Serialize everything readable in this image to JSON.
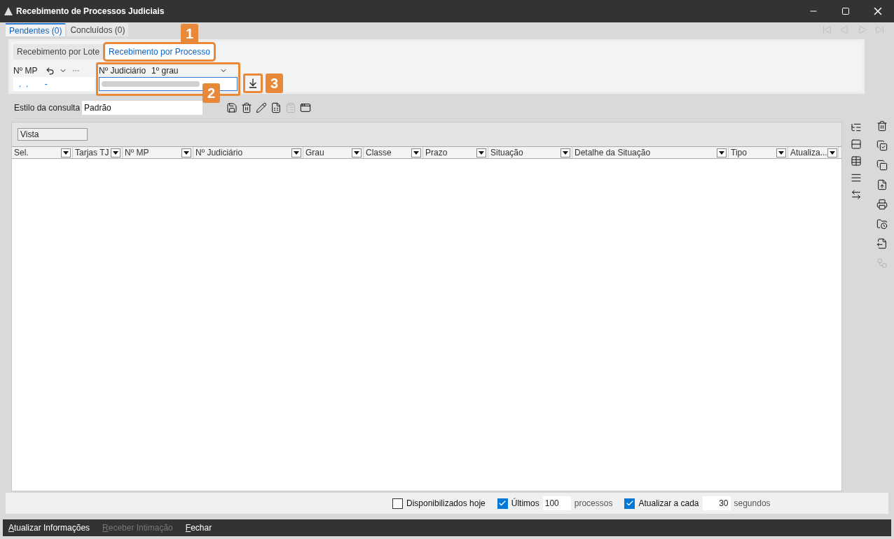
{
  "window": {
    "title": "Recebimento de Processos Judiciais"
  },
  "tabs": [
    {
      "label": "Pendentes (0)",
      "selected": true
    },
    {
      "label": "Concluídos (0)",
      "selected": false
    }
  ],
  "record_nav": [
    {
      "kind": "first",
      "disabled": true
    },
    {
      "kind": "prev",
      "disabled": true
    },
    {
      "kind": "next",
      "disabled": true
    },
    {
      "kind": "last",
      "disabled": true
    }
  ],
  "sub_tabs": [
    {
      "label": "Recebimento por Lote",
      "selected": false,
      "highlighted": false
    },
    {
      "label": "Recebimento por Processo",
      "selected": true,
      "highlighted": true,
      "callout": "1"
    }
  ],
  "mp_field": {
    "label": "Nº MP",
    "value": ".  .       -"
  },
  "judicial_field": {
    "label": "Nº Judiciário",
    "grade": "1º grau",
    "highlighted": true,
    "callout": "2"
  },
  "download_button": {
    "highlighted": true,
    "callout": "3"
  },
  "query_style": {
    "label": "Estilo da consulta",
    "value": "Padrão"
  },
  "style_toolbar": [
    {
      "kind": "save",
      "disabled": false
    },
    {
      "kind": "delete",
      "disabled": false
    },
    {
      "kind": "edit",
      "disabled": false
    },
    {
      "kind": "excel",
      "disabled": false
    },
    {
      "kind": "clipboard",
      "disabled": true
    },
    {
      "kind": "export",
      "disabled": false
    }
  ],
  "grid": {
    "group_box": "Vista",
    "columns": [
      "Sel.",
      "Tarjas TJ",
      "Nº MP",
      "Nº Judiciário",
      "Grau",
      "Classe",
      "Prazo",
      "Situação",
      "Detalhe da Situação",
      "Tipo",
      "Atualiza..."
    ]
  },
  "grid_tools": [
    {
      "kind": "tree",
      "disabled": false
    },
    {
      "kind": "rows",
      "disabled": false
    },
    {
      "kind": "table",
      "disabled": false
    },
    {
      "kind": "list",
      "disabled": false
    },
    {
      "kind": "fit",
      "disabled": false
    }
  ],
  "side_tools": [
    {
      "kind": "delete",
      "disabled": false
    },
    {
      "kind": "copy-check",
      "disabled": false
    },
    {
      "kind": "copy",
      "disabled": false
    },
    {
      "kind": "file-up",
      "disabled": false
    },
    {
      "kind": "print",
      "disabled": false
    },
    {
      "kind": "folder-clock",
      "disabled": false
    },
    {
      "kind": "file-out",
      "disabled": false
    },
    {
      "kind": "workflow",
      "disabled": true
    }
  ],
  "options": {
    "today": {
      "label": "Disponibilizados hoje",
      "checked": false
    },
    "last": {
      "label": "Últimos",
      "checked": true,
      "value": "100",
      "suffix": "processos"
    },
    "refresh": {
      "label": "Atualizar a cada",
      "checked": true,
      "value": "30",
      "suffix": "segundos"
    }
  },
  "footer_buttons": [
    {
      "label": "Atualizar Informações",
      "disabled": false
    },
    {
      "label": "Receber Intimação",
      "disabled": true
    },
    {
      "label": "Fechar",
      "disabled": false
    }
  ]
}
